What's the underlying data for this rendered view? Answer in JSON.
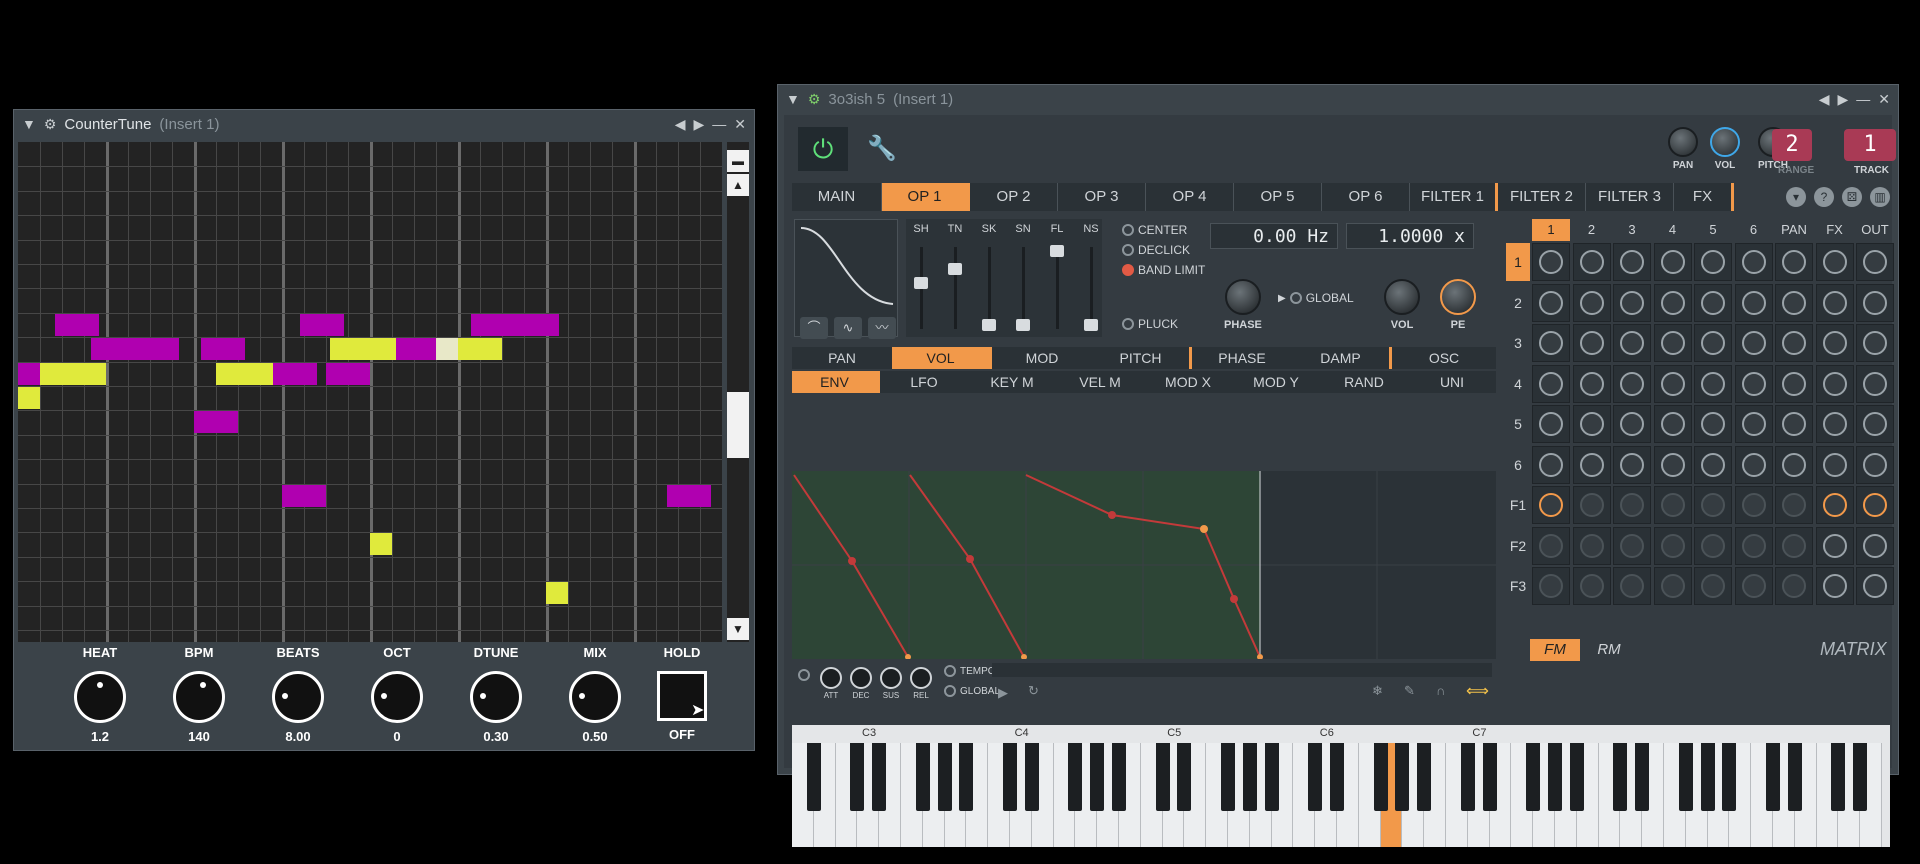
{
  "countertune": {
    "title": "CounterTune",
    "insert": "(Insert 1)",
    "knobs": [
      {
        "label": "HEAT",
        "value": "1.2"
      },
      {
        "label": "BPM",
        "value": "140"
      },
      {
        "label": "BEATS",
        "value": "8.00"
      },
      {
        "label": "OCT",
        "value": "0"
      },
      {
        "label": "DTUNE",
        "value": "0.30"
      },
      {
        "label": "MIX",
        "value": "0.50"
      }
    ],
    "hold": {
      "label": "HOLD",
      "value": "OFF"
    }
  },
  "synth": {
    "title": "3o3ish 5",
    "insert": "(Insert 1)",
    "header": {
      "pan": "PAN",
      "vol": "VOL",
      "pitch": "PITCH",
      "range_label": "RANGE",
      "range_value": "2",
      "track_label": "TRACK",
      "track_value": "1"
    },
    "tabs": [
      "MAIN",
      "OP 1",
      "OP 2",
      "OP 3",
      "OP 4",
      "OP 5",
      "OP 6",
      "FILTER 1",
      "FILTER 2",
      "FILTER 3",
      "FX"
    ],
    "fader_labels": [
      "SH",
      "TN",
      "SK",
      "SN",
      "FL",
      "NS"
    ],
    "options": {
      "center": "CENTER",
      "declick": "DECLICK",
      "band_limit": "BAND LIMIT",
      "pluck": "PLUCK",
      "global": "GLOBAL"
    },
    "freq": "0.00 Hz",
    "ratio": "1.0000 x",
    "knob_phase": "PHASE",
    "knob_vol": "VOL",
    "knob_pe": "PE",
    "mod_tabs": [
      "PAN",
      "VOL",
      "MOD",
      "PITCH",
      "PHASE",
      "DAMP",
      "OSC"
    ],
    "env_tabs": [
      "ENV",
      "LFO",
      "KEY M",
      "VEL M",
      "MOD X",
      "MOD Y",
      "RAND",
      "UNI"
    ],
    "env_knobs": [
      "ATT",
      "DEC",
      "SUS",
      "REL"
    ],
    "env_opts": {
      "tempo": "TEMPO",
      "global": "GLOBAL"
    },
    "matrix_cols": [
      "1",
      "2",
      "3",
      "4",
      "5",
      "6",
      "PAN",
      "FX",
      "OUT"
    ],
    "matrix_rows": [
      "1",
      "2",
      "3",
      "4",
      "5",
      "6",
      "F1",
      "F2",
      "F3"
    ],
    "fm": "FM",
    "rm": "RM",
    "matrix_label": "MATRIX",
    "octaves": [
      "C3",
      "C4",
      "C5",
      "C6",
      "C7"
    ]
  }
}
